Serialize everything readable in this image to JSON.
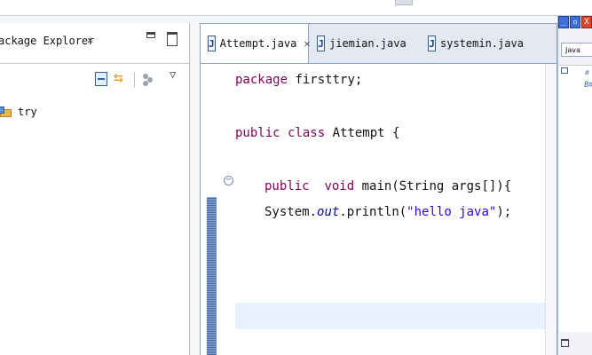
{
  "package_explorer": {
    "title": "ackage Explorer",
    "close_glyph": "✕",
    "menu_glyph": "▽",
    "tree": [
      {
        "label": "try",
        "icon": "java-project-icon"
      }
    ]
  },
  "editor": {
    "tabs": [
      {
        "label": "Attempt.java",
        "active": true,
        "close": "✕"
      },
      {
        "label": "jiemian.java",
        "active": false
      },
      {
        "label": "systemin.java",
        "active": false
      }
    ],
    "code_lines": [
      {
        "id": "l1",
        "kw": "package",
        "rest": " firsttry;"
      },
      {
        "id": "l2",
        "kw": "public class",
        "rest": " Attempt {"
      },
      {
        "id": "l3",
        "kw1": "public",
        "kw2": "void",
        "rest": " main(String args[]){"
      },
      {
        "id": "l4",
        "pre": "System.",
        "field": "out",
        "mid": ".println(",
        "str": "\"hello java\"",
        "post": ");"
      }
    ]
  },
  "right_dock": {
    "perspective_label": "Java",
    "window_buttons": [
      "_",
      "▫",
      "X"
    ]
  },
  "colors": {
    "keyword": "#7f0055",
    "string": "#2a00ff",
    "field": "#0000c0",
    "current_line": "#e8f2fe"
  }
}
